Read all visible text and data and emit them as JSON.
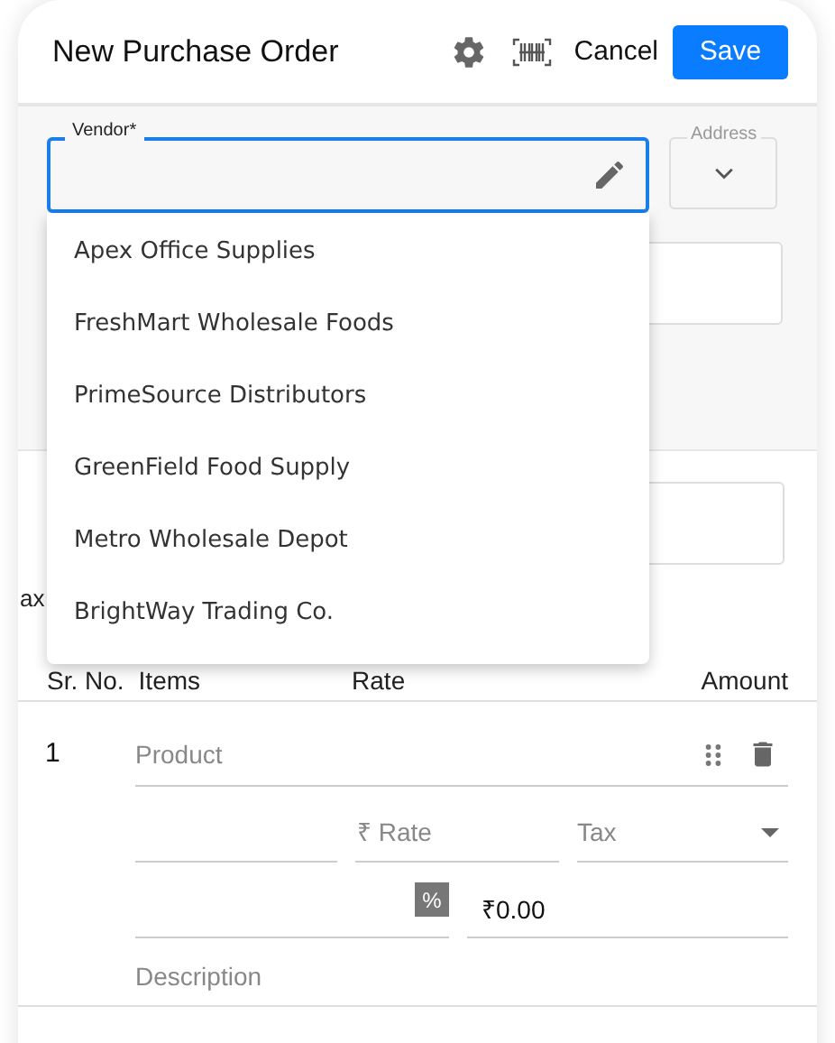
{
  "header": {
    "title": "New Purchase Order",
    "cancel": "Cancel",
    "save": "Save"
  },
  "vendor": {
    "label": "Vendor*",
    "focused": true
  },
  "address": {
    "label": "Address"
  },
  "vendor_options": [
    "Apex Office Supplies",
    "FreshMart Wholesale Foods",
    "PrimeSource Distributors",
    "GreenField Food Supply",
    "Metro Wholesale Depot",
    "BrightWay Trading Co."
  ],
  "partial_label": "ax",
  "table": {
    "columns": [
      "Sr. No.",
      "Items",
      "Rate",
      "Amount"
    ]
  },
  "line_items": [
    {
      "number": "1",
      "product": {
        "placeholder": "Product"
      },
      "rate": {
        "placeholder": "₹ Rate"
      },
      "tax": {
        "placeholder": "Tax"
      },
      "discount_unit": "%",
      "amount": "₹0.00",
      "description": {
        "placeholder": "Description"
      }
    }
  ]
}
